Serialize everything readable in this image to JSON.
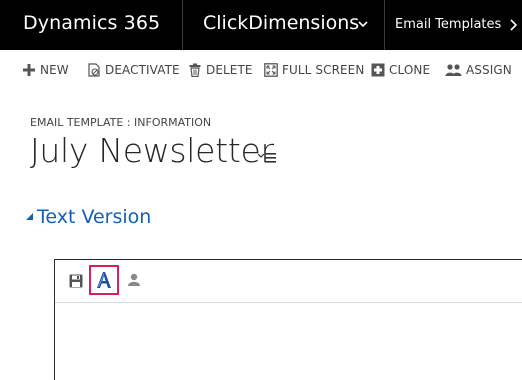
{
  "topbar": {
    "app_name": "Dynamics 365",
    "area_name": "ClickDimensions",
    "entity_name": "Email Templates"
  },
  "commands": [
    {
      "label": "NEW",
      "icon": "plus-icon"
    },
    {
      "label": "DEACTIVATE",
      "icon": "deactivate-icon"
    },
    {
      "label": "DELETE",
      "icon": "trash-icon"
    },
    {
      "label": "FULL SCREEN",
      "icon": "fullscreen-icon"
    },
    {
      "label": "CLONE",
      "icon": "clone-icon"
    },
    {
      "label": "ASSIGN",
      "icon": "assign-icon"
    }
  ],
  "form": {
    "type_label": "EMAIL TEMPLATE : INFORMATION",
    "title": "July Newsletter"
  },
  "section": {
    "label": "Text Version"
  },
  "editor": {
    "tools": [
      "save-icon",
      "font-style-icon",
      "user-icon"
    ],
    "highlight_color": "#d8215a"
  },
  "colors": {
    "nav_bg": "#000000",
    "link_blue": "#1160b7"
  }
}
